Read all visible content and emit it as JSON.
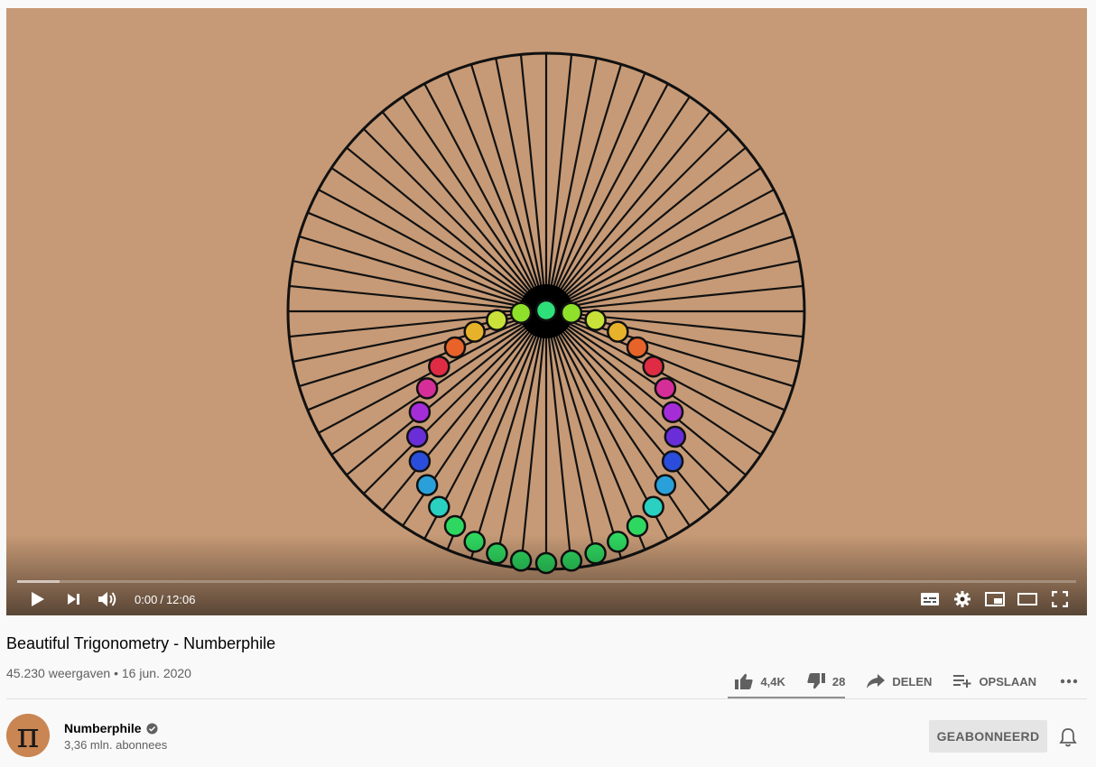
{
  "video": {
    "current_time": "0:00",
    "duration": "12:06",
    "time_separator": "/",
    "buffered_fraction": 0.04
  },
  "video_info": {
    "title": "Beautiful Trigonometry - Numberphile",
    "views": "45.230 weergaven",
    "bullet": "•",
    "date": "16 jun. 2020"
  },
  "actions": {
    "likes": "4,4K",
    "dislikes": "28",
    "share_label": "DELEN",
    "save_label": "OPSLAAN"
  },
  "channel": {
    "name": "Numberphile",
    "subscribers": "3,36 mln. abonnees",
    "subscribe_label": "GEABONNEERD",
    "avatar_glyph": "π"
  },
  "icons": [
    "play-icon",
    "next-icon",
    "volume-icon",
    "subtitles-icon",
    "settings-icon",
    "miniplayer-icon",
    "theater-icon",
    "fullscreen-icon",
    "like-icon",
    "dislike-icon",
    "share-icon",
    "save-playlist-icon",
    "more-icon",
    "verified-icon",
    "bell-icon"
  ],
  "colors": {
    "cardboard": "#c69a76",
    "page_bg": "#f9f9f9",
    "subscribe_bg": "#e5e5e5",
    "ball_palette": [
      "#2ee07a",
      "#8fe02a",
      "#c9e23a",
      "#e6b22a",
      "#e8632a",
      "#df2c44",
      "#d62e98",
      "#a52dd8",
      "#6a2ed8",
      "#2a4ddb",
      "#2aa0db",
      "#2ad0c0",
      "#2ed860"
    ]
  }
}
